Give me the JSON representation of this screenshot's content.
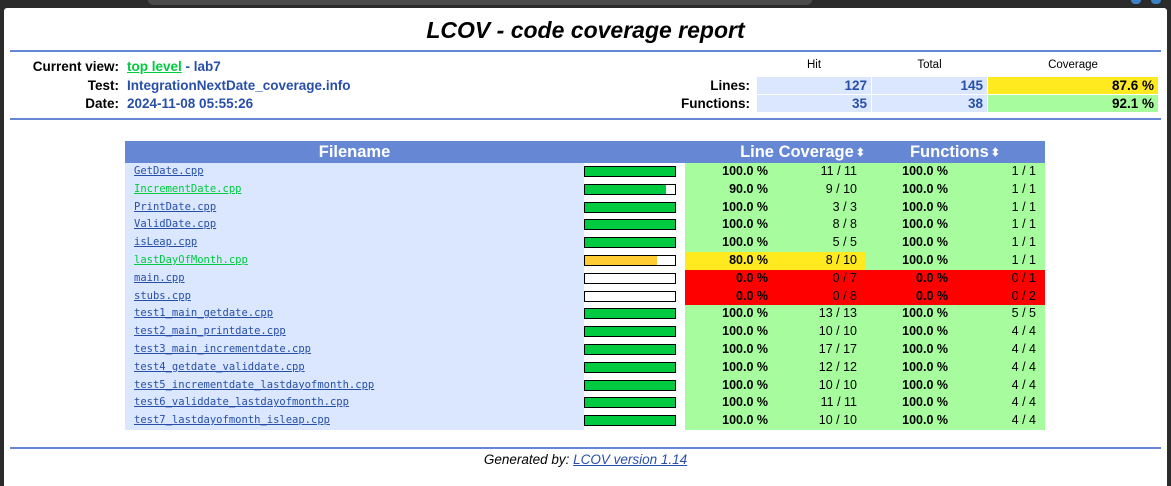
{
  "page_title": "LCOV - code coverage report",
  "info": {
    "current_view_label": "Current view:",
    "top_level_link": "top level",
    "view_separator": " - ",
    "view_name": "lab7",
    "test_label": "Test:",
    "test_value": "IntegrationNextDate_coverage.info",
    "date_label": "Date:",
    "date_value": "2024-11-08 05:55:26"
  },
  "summary": {
    "headers": {
      "hit": "Hit",
      "total": "Total",
      "coverage": "Coverage"
    },
    "lines": {
      "label": "Lines:",
      "hit": "127",
      "total": "145",
      "coverage": "87.6 %"
    },
    "functions": {
      "label": "Functions:",
      "hit": "35",
      "total": "38",
      "coverage": "92.1 %"
    }
  },
  "table": {
    "headers": {
      "filename": "Filename",
      "line_coverage": "Line Coverage",
      "functions": "Functions"
    },
    "sort_icon": "sort-arrows-icon",
    "rows": [
      {
        "file": "GetDate.cpp",
        "link_color": "blue",
        "coverage_fraction": 1.0,
        "line_pct": "100.0 %",
        "line_hits": "11 / 11",
        "line_level": "hi",
        "func_pct": "100.0 %",
        "func_hits": "1 / 1",
        "func_level": "hi"
      },
      {
        "file": "IncrementDate.cpp",
        "link_color": "green",
        "coverage_fraction": 0.9,
        "line_pct": "90.0 %",
        "line_hits": "9 / 10",
        "line_level": "hi",
        "func_pct": "100.0 %",
        "func_hits": "1 / 1",
        "func_level": "hi"
      },
      {
        "file": "PrintDate.cpp",
        "link_color": "blue",
        "coverage_fraction": 1.0,
        "line_pct": "100.0 %",
        "line_hits": "3 / 3",
        "line_level": "hi",
        "func_pct": "100.0 %",
        "func_hits": "1 / 1",
        "func_level": "hi"
      },
      {
        "file": "ValidDate.cpp",
        "link_color": "blue",
        "coverage_fraction": 1.0,
        "line_pct": "100.0 %",
        "line_hits": "8 / 8",
        "line_level": "hi",
        "func_pct": "100.0 %",
        "func_hits": "1 / 1",
        "func_level": "hi"
      },
      {
        "file": "isLeap.cpp",
        "link_color": "blue",
        "coverage_fraction": 1.0,
        "line_pct": "100.0 %",
        "line_hits": "5 / 5",
        "line_level": "hi",
        "func_pct": "100.0 %",
        "func_hits": "1 / 1",
        "func_level": "hi"
      },
      {
        "file": "lastDayOfMonth.cpp",
        "link_color": "green",
        "coverage_fraction": 0.8,
        "line_pct": "80.0 %",
        "line_hits": "8 / 10",
        "line_level": "med",
        "func_pct": "100.0 %",
        "func_hits": "1 / 1",
        "func_level": "hi"
      },
      {
        "file": "main.cpp",
        "link_color": "blue",
        "coverage_fraction": 0.0,
        "line_pct": "0.0 %",
        "line_hits": "0 / 7",
        "line_level": "lo",
        "func_pct": "0.0 %",
        "func_hits": "0 / 1",
        "func_level": "lo"
      },
      {
        "file": "stubs.cpp",
        "link_color": "blue",
        "coverage_fraction": 0.0,
        "line_pct": "0.0 %",
        "line_hits": "0 / 8",
        "line_level": "lo",
        "func_pct": "0.0 %",
        "func_hits": "0 / 2",
        "func_level": "lo"
      },
      {
        "file": "test1_main_getdate.cpp",
        "link_color": "blue",
        "coverage_fraction": 1.0,
        "line_pct": "100.0 %",
        "line_hits": "13 / 13",
        "line_level": "hi",
        "func_pct": "100.0 %",
        "func_hits": "5 / 5",
        "func_level": "hi"
      },
      {
        "file": "test2_main_printdate.cpp",
        "link_color": "blue",
        "coverage_fraction": 1.0,
        "line_pct": "100.0 %",
        "line_hits": "10 / 10",
        "line_level": "hi",
        "func_pct": "100.0 %",
        "func_hits": "4 / 4",
        "func_level": "hi"
      },
      {
        "file": "test3_main_incrementdate.cpp",
        "link_color": "blue",
        "coverage_fraction": 1.0,
        "line_pct": "100.0 %",
        "line_hits": "17 / 17",
        "line_level": "hi",
        "func_pct": "100.0 %",
        "func_hits": "4 / 4",
        "func_level": "hi"
      },
      {
        "file": "test4_getdate_validdate.cpp",
        "link_color": "blue",
        "coverage_fraction": 1.0,
        "line_pct": "100.0 %",
        "line_hits": "12 / 12",
        "line_level": "hi",
        "func_pct": "100.0 %",
        "func_hits": "4 / 4",
        "func_level": "hi"
      },
      {
        "file": "test5_incrementdate_lastdayofmonth.cpp",
        "link_color": "blue",
        "coverage_fraction": 1.0,
        "line_pct": "100.0 %",
        "line_hits": "10 / 10",
        "line_level": "hi",
        "func_pct": "100.0 %",
        "func_hits": "4 / 4",
        "func_level": "hi"
      },
      {
        "file": "test6_validdate_lastdayofmonth.cpp",
        "link_color": "blue",
        "coverage_fraction": 1.0,
        "line_pct": "100.0 %",
        "line_hits": "11 / 11",
        "line_level": "hi",
        "func_pct": "100.0 %",
        "func_hits": "4 / 4",
        "func_level": "hi"
      },
      {
        "file": "test7_lastdayofmonth_isleap.cpp",
        "link_color": "blue",
        "coverage_fraction": 1.0,
        "line_pct": "100.0 %",
        "line_hits": "10 / 10",
        "line_level": "hi",
        "func_pct": "100.0 %",
        "func_hits": "4 / 4",
        "func_level": "hi"
      }
    ]
  },
  "footer": {
    "prefix": "Generated by: ",
    "link": "LCOV version 1.14"
  },
  "colors": {
    "header_blue": "#6688d4",
    "link_blue": "#284fa8",
    "link_green": "#00cb40",
    "hi": "#a7fc9d",
    "med": "#ffea20",
    "lo": "#ff0000",
    "bar_green": "#00cb40",
    "bar_yellow": "#ffcc33",
    "row_blue": "#dae7fe"
  }
}
